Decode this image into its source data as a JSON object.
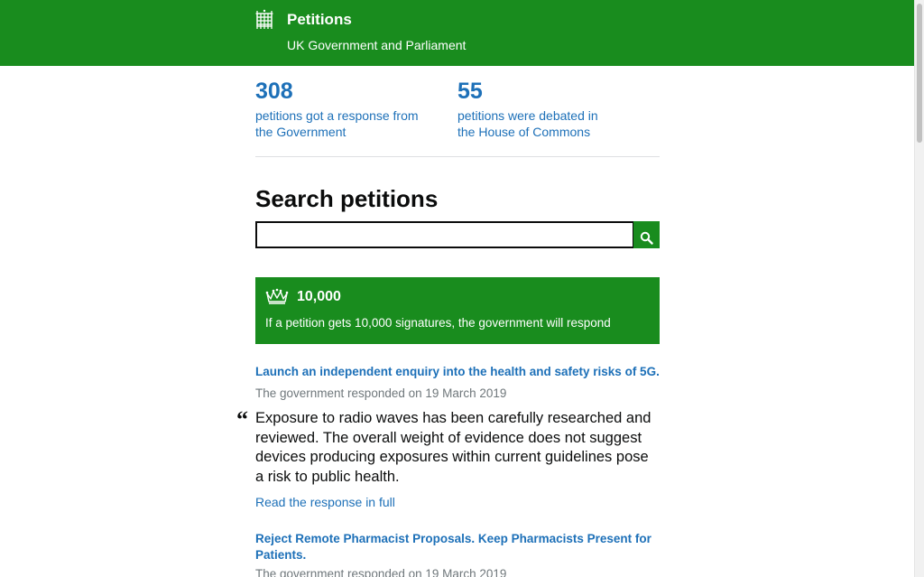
{
  "header": {
    "title": "Petitions",
    "subtitle": "UK Government and Parliament"
  },
  "stats": [
    {
      "number": "308",
      "line1": "petitions got a response from",
      "line2": "the Government"
    },
    {
      "number": "55",
      "line1": "petitions were debated in",
      "line2": "the House of Commons"
    }
  ],
  "search": {
    "heading": "Search petitions",
    "value": "",
    "placeholder": ""
  },
  "threshold": {
    "count": "10,000",
    "text": "If a petition gets 10,000 signatures, the government will respond"
  },
  "petitions": [
    {
      "title": "Launch an independent enquiry into the health and safety risks of 5G.",
      "response_date": "The government responded on 19 March 2019",
      "quote": "Exposure to radio waves has been carefully researched and reviewed. The overall weight of evidence does not suggest devices producing exposures within current guidelines pose a risk to public health.",
      "link": "Read the response in full"
    },
    {
      "title": "Reject Remote Pharmacist Proposals. Keep Pharmacists Present for Patients.",
      "response_date": "The government responded on 19 March 2019"
    }
  ],
  "colors": {
    "brand_green": "#198c1e",
    "link_blue": "#1d70b8",
    "secondary_text": "#6f777b"
  },
  "icons": {
    "header_logo": "portcullis-icon",
    "search_button": "search-icon",
    "threshold": "crown-icon",
    "quote": "quote-icon"
  }
}
